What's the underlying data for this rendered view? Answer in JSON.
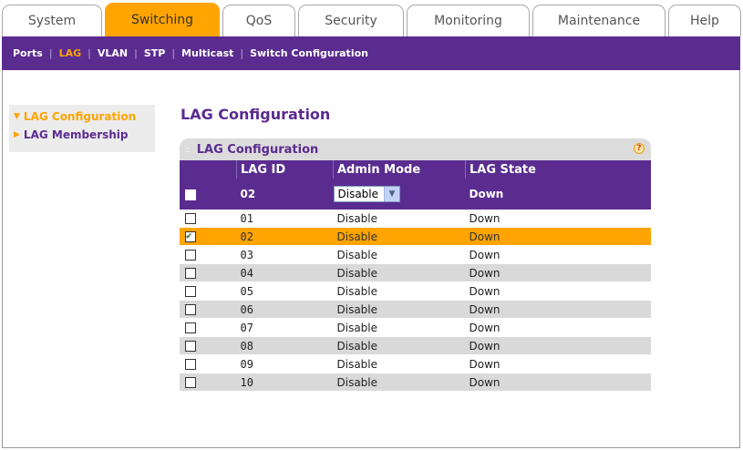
{
  "tabs": [
    {
      "label": "System"
    },
    {
      "label": "Switching"
    },
    {
      "label": "QoS"
    },
    {
      "label": "Security"
    },
    {
      "label": "Monitoring"
    },
    {
      "label": "Maintenance"
    },
    {
      "label": "Help"
    }
  ],
  "active_tab": "Switching",
  "subnav": {
    "items": [
      "Ports",
      "LAG",
      "VLAN",
      "STP",
      "Multicast",
      "Switch Configuration"
    ],
    "active": "LAG"
  },
  "leftmenu": {
    "items": [
      {
        "label": "LAG Configuration",
        "active": true
      },
      {
        "label": "LAG Membership",
        "active": false
      }
    ]
  },
  "page_title": "LAG Configuration",
  "section": {
    "title": "LAG Configuration",
    "help_icon": "?"
  },
  "table": {
    "columns": [
      "LAG ID",
      "Admin Mode",
      "LAG State"
    ],
    "edit_row": {
      "lag_id": "02",
      "admin_mode": "Disable",
      "state": "Down",
      "checked": false
    },
    "rows": [
      {
        "lag_id": "01",
        "admin_mode": "Disable",
        "state": "Down",
        "checked": false
      },
      {
        "lag_id": "02",
        "admin_mode": "Disable",
        "state": "Down",
        "checked": true
      },
      {
        "lag_id": "03",
        "admin_mode": "Disable",
        "state": "Down",
        "checked": false
      },
      {
        "lag_id": "04",
        "admin_mode": "Disable",
        "state": "Down",
        "checked": false
      },
      {
        "lag_id": "05",
        "admin_mode": "Disable",
        "state": "Down",
        "checked": false
      },
      {
        "lag_id": "06",
        "admin_mode": "Disable",
        "state": "Down",
        "checked": false
      },
      {
        "lag_id": "07",
        "admin_mode": "Disable",
        "state": "Down",
        "checked": false
      },
      {
        "lag_id": "08",
        "admin_mode": "Disable",
        "state": "Down",
        "checked": false
      },
      {
        "lag_id": "09",
        "admin_mode": "Disable",
        "state": "Down",
        "checked": false
      },
      {
        "lag_id": "10",
        "admin_mode": "Disable",
        "state": "Down",
        "checked": false
      }
    ]
  },
  "colors": {
    "purple": "#5a2c90",
    "orange": "#ffa400",
    "row_gray": "#d9d9d9"
  }
}
